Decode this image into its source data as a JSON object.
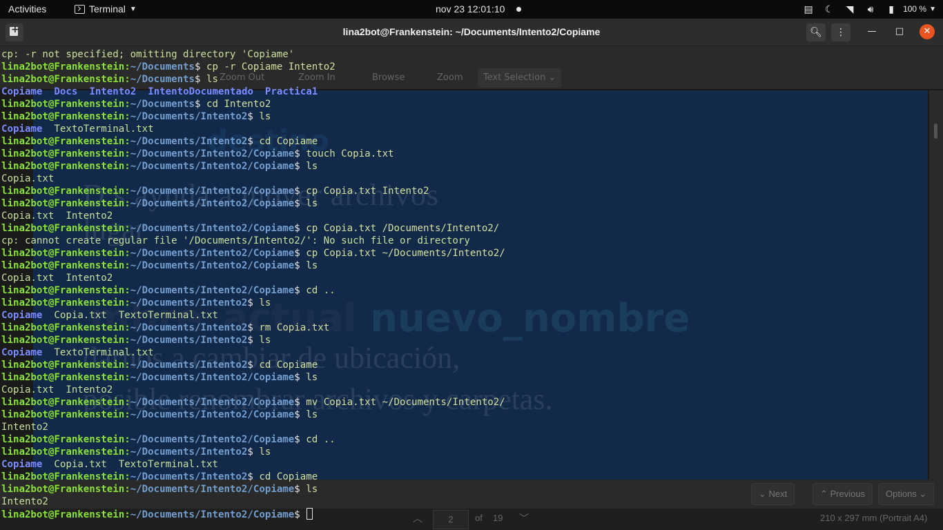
{
  "topbar": {
    "activities": "Activities",
    "app_name": "Terminal",
    "clock": "nov 23  12:01:10",
    "battery": "100 %"
  },
  "window": {
    "title": "lina2bot@Frankenstein: ~/Documents/Intento2/Copiame"
  },
  "background_viewer": {
    "toolbar": {
      "zoom_out": "Zoom Out",
      "zoom_in": "Zoom In",
      "browse": "Browse",
      "zoom": "Zoom",
      "text_selection": "Text Selection"
    },
    "page_text": {
      "heading": "destino",
      "line1": "D              s    ayuda   a   mover   archivos",
      "line2": "                                 lugar",
      "big_a": "mbre_actual ",
      "big_b": "nuevo_nombre",
      "line3": "                 darnos a cambiar de ubicación,",
      "line4": "  posible renombrar archivos y carpetas."
    },
    "find": {
      "next": "Next",
      "previous": "Previous",
      "options": "Options"
    },
    "pager": {
      "page": "2",
      "of": "of",
      "total": "19",
      "page_size": "210 x 297 mm (Portrait A4)"
    }
  },
  "terminal": {
    "user_host": "lina2bot@Frankenstein:",
    "lines": [
      {
        "type": "output",
        "text": "cp: -r not specified; omitting directory 'Copiame'"
      },
      {
        "type": "prompt",
        "path": "~/Documents",
        "cmd": " cp -r Copiame Intento2"
      },
      {
        "type": "prompt",
        "path": "~/Documents",
        "cmd": " ls"
      },
      {
        "type": "listing",
        "items": [
          {
            "t": "Copiame",
            "d": true
          },
          {
            "t": "  ",
            "d": false
          },
          {
            "t": "Docs",
            "d": true
          },
          {
            "t": "  ",
            "d": false
          },
          {
            "t": "Intento2",
            "d": true
          },
          {
            "t": "  ",
            "d": false
          },
          {
            "t": "IntentoDocumentado",
            "d": true
          },
          {
            "t": "  ",
            "d": false
          },
          {
            "t": "Practica1",
            "d": true
          }
        ]
      },
      {
        "type": "prompt",
        "path": "~/Documents",
        "cmd": " cd Intento2"
      },
      {
        "type": "prompt",
        "path": "~/Documents/Intento2",
        "cmd": " ls"
      },
      {
        "type": "listing",
        "items": [
          {
            "t": "Copiame",
            "d": true
          },
          {
            "t": "  TextoTerminal.txt",
            "d": false
          }
        ]
      },
      {
        "type": "prompt",
        "path": "~/Documents/Intento2",
        "cmd": " cd Copiame"
      },
      {
        "type": "prompt",
        "path": "~/Documents/Intento2/Copiame",
        "cmd": " touch Copia.txt"
      },
      {
        "type": "prompt",
        "path": "~/Documents/Intento2/Copiame",
        "cmd": " ls"
      },
      {
        "type": "output",
        "text": "Copia.txt"
      },
      {
        "type": "prompt",
        "path": "~/Documents/Intento2/Copiame",
        "cmd": " cp Copia.txt Intento2"
      },
      {
        "type": "prompt",
        "path": "~/Documents/Intento2/Copiame",
        "cmd": " ls"
      },
      {
        "type": "output",
        "text": "Copia.txt  Intento2"
      },
      {
        "type": "prompt",
        "path": "~/Documents/Intento2/Copiame",
        "cmd": " cp Copia.txt /Documents/Intento2/"
      },
      {
        "type": "output",
        "text": "cp: cannot create regular file '/Documents/Intento2/': No such file or directory"
      },
      {
        "type": "prompt",
        "path": "~/Documents/Intento2/Copiame",
        "cmd": " cp Copia.txt ~/Documents/Intento2/"
      },
      {
        "type": "prompt",
        "path": "~/Documents/Intento2/Copiame",
        "cmd": " ls"
      },
      {
        "type": "output",
        "text": "Copia.txt  Intento2"
      },
      {
        "type": "prompt",
        "path": "~/Documents/Intento2/Copiame",
        "cmd": " cd .."
      },
      {
        "type": "prompt",
        "path": "~/Documents/Intento2",
        "cmd": " ls"
      },
      {
        "type": "listing",
        "items": [
          {
            "t": "Copiame",
            "d": true
          },
          {
            "t": "  Copia.txt  TextoTerminal.txt",
            "d": false
          }
        ]
      },
      {
        "type": "prompt",
        "path": "~/Documents/Intento2",
        "cmd": " rm Copia.txt"
      },
      {
        "type": "prompt",
        "path": "~/Documents/Intento2",
        "cmd": " ls"
      },
      {
        "type": "listing",
        "items": [
          {
            "t": "Copiame",
            "d": true
          },
          {
            "t": "  TextoTerminal.txt",
            "d": false
          }
        ]
      },
      {
        "type": "prompt",
        "path": "~/Documents/Intento2",
        "cmd": " cd Copiame"
      },
      {
        "type": "prompt",
        "path": "~/Documents/Intento2/Copiame",
        "cmd": " ls"
      },
      {
        "type": "output",
        "text": "Copia.txt  Intento2"
      },
      {
        "type": "prompt",
        "path": "~/Documents/Intento2/Copiame",
        "cmd": " mv Copia.txt ~/Documents/Intento2/"
      },
      {
        "type": "prompt",
        "path": "~/Documents/Intento2/Copiame",
        "cmd": " ls"
      },
      {
        "type": "output",
        "text": "Intento2"
      },
      {
        "type": "prompt",
        "path": "~/Documents/Intento2/Copiame",
        "cmd": " cd .."
      },
      {
        "type": "prompt",
        "path": "~/Documents/Intento2",
        "cmd": " ls"
      },
      {
        "type": "listing",
        "items": [
          {
            "t": "Copiame",
            "d": true
          },
          {
            "t": "  Copia.txt  TextoTerminal.txt",
            "d": false
          }
        ]
      },
      {
        "type": "prompt",
        "path": "~/Documents/Intento2",
        "cmd": " cd Copiame"
      },
      {
        "type": "prompt",
        "path": "~/Documents/Intento2/Copiame",
        "cmd": " ls"
      },
      {
        "type": "output",
        "text": "Intento2"
      },
      {
        "type": "prompt",
        "path": "~/Documents/Intento2/Copiame",
        "cmd": " ",
        "cursor": true
      }
    ]
  },
  "colors": {
    "accent_close": "#e95420",
    "prompt_user": "#8ae234",
    "prompt_path": "#729fcf",
    "dir_listing": "#7a8cff"
  }
}
